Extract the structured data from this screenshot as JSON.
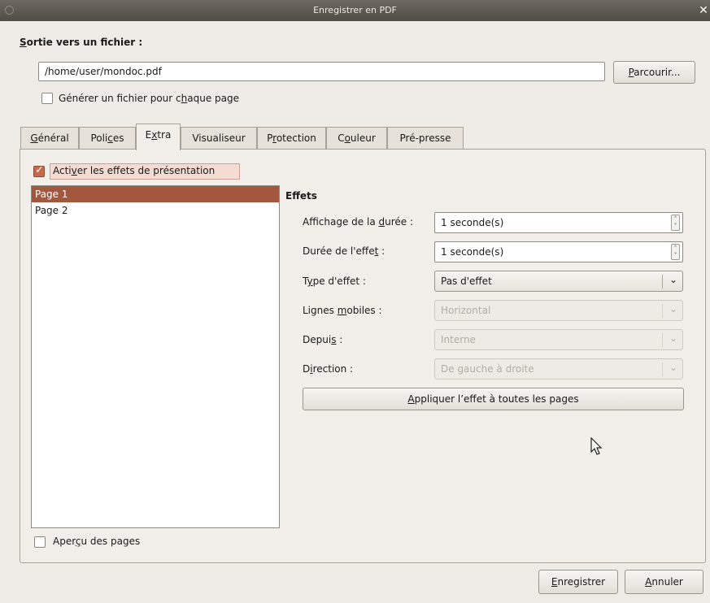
{
  "window": {
    "title": "Enregistrer en PDF"
  },
  "output": {
    "section_title_prefix": "S",
    "section_title_rest": "ortie vers un fichier :",
    "file_path": "/home/user/mondoc.pdf",
    "browse_prefix": "P",
    "browse_rest": "arcourir...",
    "per_page_pre": "Générer un fichier pour c",
    "per_page_u": "h",
    "per_page_post": "aque page",
    "per_page_checked": false
  },
  "tabs": [
    {
      "pre": "",
      "u": "G",
      "post": "énéral"
    },
    {
      "pre": "Poli",
      "u": "c",
      "post": "es"
    },
    {
      "pre": "E",
      "u": "x",
      "post": "tra"
    },
    {
      "pre": "Visualiseur",
      "u": "",
      "post": ""
    },
    {
      "pre": "P",
      "u": "r",
      "post": "otection"
    },
    {
      "pre": "C",
      "u": "o",
      "post": "uleur"
    },
    {
      "pre": "Pré-presse",
      "u": "",
      "post": ""
    }
  ],
  "active_tab": "Extra",
  "extra": {
    "enable_pre": "Acti",
    "enable_u": "v",
    "enable_post": "er les effets de présentation",
    "enable_checked": true,
    "pages": [
      "Page 1",
      "Page 2"
    ],
    "selected_page": "Page 1",
    "preview_pre": "Aper",
    "preview_u": "ç",
    "preview_post": "u des pages",
    "preview_checked": false
  },
  "effects": {
    "title": "Effets",
    "display_pre": "Affichage de la ",
    "display_u": "d",
    "display_post": "urée :",
    "display_value": "1 seconde(s)",
    "effect_pre": "Durée de l'effe",
    "effect_u": "t",
    "effect_post": " :",
    "effect_value": "1 seconde(s)",
    "type_pre": "T",
    "type_u": "y",
    "type_post": "pe d'effet :",
    "type_value": "Pas d'effet",
    "lines_pre": "Lignes ",
    "lines_u": "m",
    "lines_post": "obiles :",
    "lines_value": "Horizontal",
    "from_pre": "Depui",
    "from_u": "s",
    "from_post": " :",
    "from_value": "Interne",
    "dir_pre": "D",
    "dir_u": "i",
    "dir_post": "rection :",
    "dir_value": "De gauche à droite",
    "apply_u": "A",
    "apply_rest": "ppliquer l’effet à toutes les pages"
  },
  "footer": {
    "save_u": "E",
    "save_rest": "nregistrer",
    "cancel_u": "A",
    "cancel_rest": "nnuler"
  }
}
